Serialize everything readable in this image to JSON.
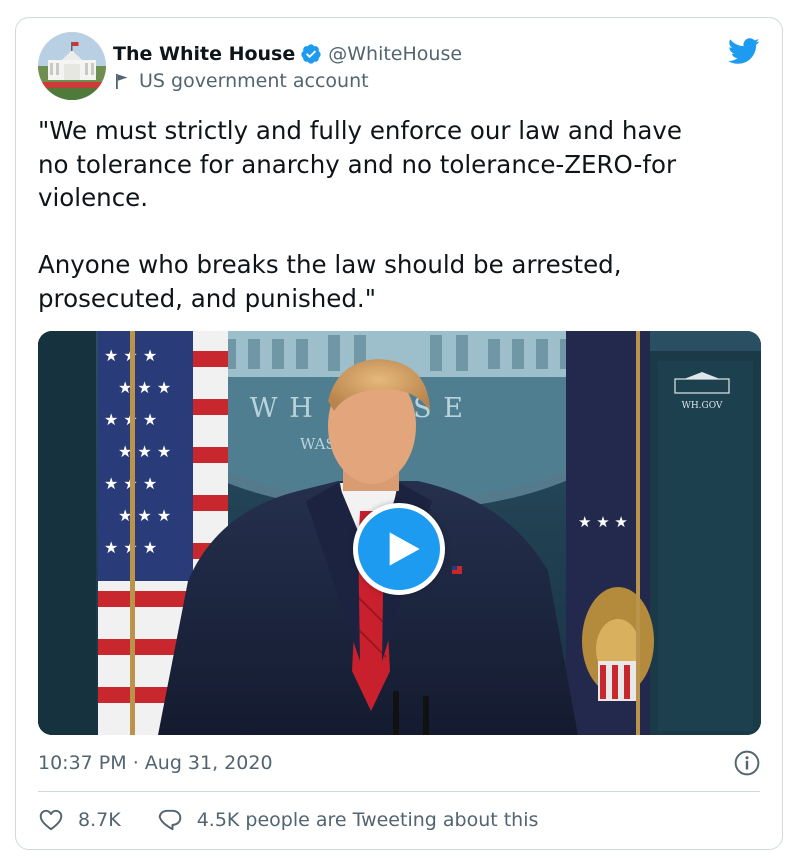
{
  "account": {
    "display_name": "The White House",
    "handle": "@WhiteHouse",
    "label": "US government account",
    "avatar_icon": "white-house-avatar",
    "verified_icon": "verified-badge-icon",
    "label_icon": "flag-icon",
    "brand_icon": "twitter-bird-icon"
  },
  "tweet": {
    "text": "\"We must strictly and fully enforce our law and have\nno tolerance for anarchy and no tolerance-ZERO-for\nviolence.\n\nAnyone who breaks the law should be arrested,\nprosecuted, and punished.\""
  },
  "media": {
    "type": "video",
    "play_icon": "play-icon",
    "backdrop_text": "THE WH    OUSE",
    "backdrop_text_2": "WAS",
    "wh_gov": "WH.GOV"
  },
  "meta": {
    "time": "10:37 PM",
    "separator": " · ",
    "date": "Aug 31, 2020",
    "info_icon": "info-icon"
  },
  "actions": {
    "like_count": "8.7K",
    "like_icon": "heart-icon",
    "reply_text": "4.5K people are Tweeting about this",
    "reply_icon": "speech-bubble-icon"
  },
  "colors": {
    "brand": "#1d9bf0",
    "text": "#0f1419",
    "secondary": "#536471",
    "border": "#cfd9de"
  }
}
